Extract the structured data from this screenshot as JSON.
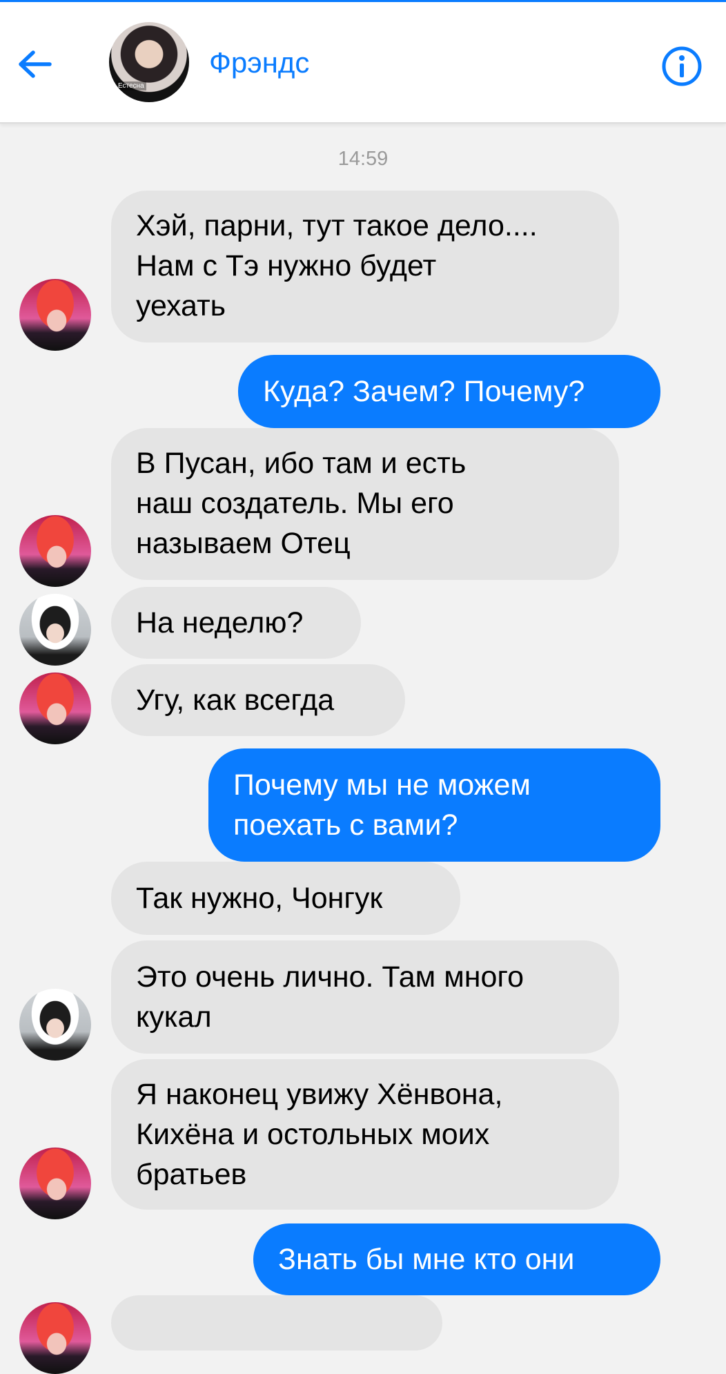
{
  "header": {
    "title": "Фрэндс",
    "avatar_caption": "Естесна",
    "back_icon": "arrow-left-icon",
    "info_icon": "info-circle-icon",
    "accent_color": "#0a7cff"
  },
  "timestamp": "14:59",
  "messages": [
    {
      "side": "in",
      "text": "Хэй, парни, тут такое дело....\nНам с Тэ нужно будет\nуехать"
    },
    {
      "side": "out",
      "text": "Куда? Зачем? Почему?"
    },
    {
      "side": "in",
      "text": "В Пусан, ибо там и есть\nнаш создатель. Мы его\nназываем Отец"
    },
    {
      "side": "in",
      "text": "На неделю?"
    },
    {
      "side": "in",
      "text": "Угу, как всегда"
    },
    {
      "side": "out",
      "text": "Почему мы не можем\nпоехать с вами?"
    },
    {
      "side": "in",
      "text": "Так нужно, Чонгук"
    },
    {
      "side": "in",
      "text": "Это очень лично. Там много\nкукал"
    },
    {
      "side": "in",
      "text": "Я наконец увижу Хёнвона,\nКихёна и остольных моих\nбратьев"
    },
    {
      "side": "out",
      "text": "Знать бы мне кто они"
    }
  ]
}
